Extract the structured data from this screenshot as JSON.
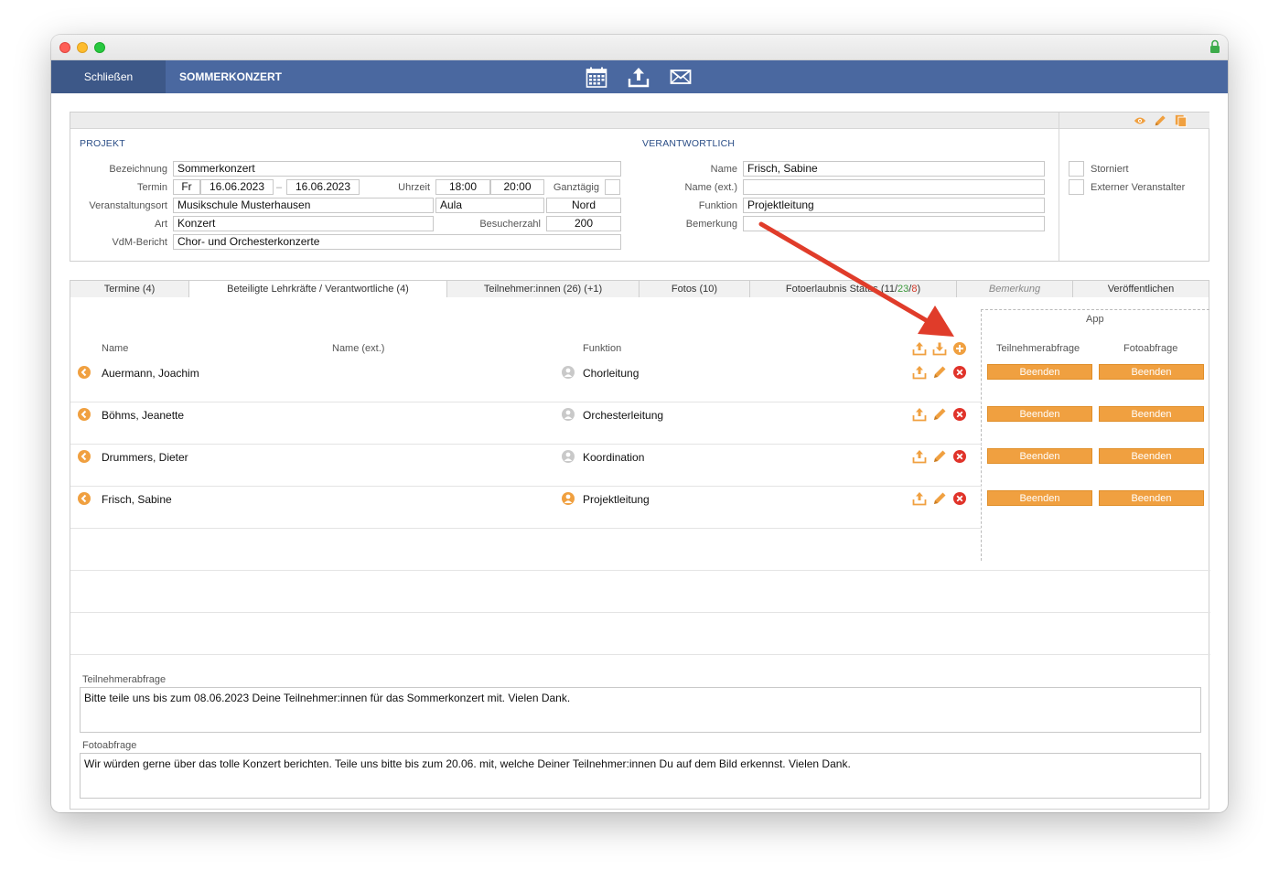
{
  "nav": {
    "close_label": "Schließen",
    "title": "SOMMERKONZERT",
    "icons": [
      "calendar-icon",
      "upload-icon",
      "mail-icon"
    ]
  },
  "projekt": {
    "section_title": "PROJEKT",
    "bezeichnung_label": "Bezeichnung",
    "bezeichnung_value": "Sommerkonzert",
    "termin_label": "Termin",
    "termin_day": "Fr",
    "termin_from": "16.06.2023",
    "termin_sep": "–",
    "termin_to": "16.06.2023",
    "uhrzeit_label": "Uhrzeit",
    "uhrzeit_from": "18:00",
    "uhrzeit_to": "20:00",
    "ganztaegig_label": "Ganztägig",
    "ort_label": "Veranstaltungsort",
    "ort_value": "Musikschule Musterhausen",
    "ort_room": "Aula",
    "ort_region": "Nord",
    "art_label": "Art",
    "art_value": "Konzert",
    "besucherzahl_label": "Besucherzahl",
    "besucherzahl_value": "200",
    "vdm_label": "VdM-Bericht",
    "vdm_value": "Chor- und Orchesterkonzerte"
  },
  "verantwortlich": {
    "section_title": "VERANTWORTLICH",
    "name_label": "Name",
    "name_value": "Frisch, Sabine",
    "name_ext_label": "Name (ext.)",
    "name_ext_value": "",
    "funktion_label": "Funktion",
    "funktion_value": "Projektleitung",
    "bemerkung_label": "Bemerkung",
    "bemerkung_value": ""
  },
  "flags": {
    "storniert_label": "Storniert",
    "externer_label": "Externer Veranstalter"
  },
  "tabs": {
    "termine": "Termine (4)",
    "lehrkraefte": "Beteiligte Lehrkräfte / Verantwortliche (4)",
    "teilnehmer": "Teilnehmer:innen (26) (+1)",
    "fotos": "Fotos (10)",
    "fotoerlaubnis_prefix": "Fotoerlaubnis Status (",
    "fotoerlaubnis_a": "11",
    "fotoerlaubnis_sep1": "/",
    "fotoerlaubnis_b": "23",
    "fotoerlaubnis_sep2": "/",
    "fotoerlaubnis_c": "8",
    "fotoerlaubnis_suffix": ")",
    "bemerkung": "Bemerkung",
    "veroeffentlichen": "Veröffentlichen"
  },
  "table": {
    "col_name": "Name",
    "col_name_ext": "Name (ext.)",
    "col_funktion": "Funktion",
    "app_title": "App",
    "col_teilnehmerabfrage": "Teilnehmerabfrage",
    "col_fotoabfrage": "Fotoabfrage",
    "button_label": "Beenden",
    "rows": [
      {
        "name": "Auermann, Joachim",
        "funktion": "Chorleitung"
      },
      {
        "name": "Böhms, Jeanette",
        "funktion": "Orchesterleitung"
      },
      {
        "name": "Drummers, Dieter",
        "funktion": "Koordination"
      },
      {
        "name": "Frisch, Sabine",
        "funktion": "Projektleitung"
      }
    ]
  },
  "teilnehmerabfrage": {
    "label": "Teilnehmerabfrage",
    "text": "Bitte teile uns bis zum 08.06.2023 Deine Teilnehmer:innen für das Sommerkonzert mit. Vielen Dank."
  },
  "fotoabfrage": {
    "label": "Fotoabfrage",
    "text": "Wir würden gerne über das tolle Konzert berichten. Teile uns bitte bis zum 20.06. mit, welche Deiner Teilnehmer:innen Du auf dem Bild erkennst. Vielen Dank."
  },
  "colors": {
    "nav": "#4a68a0",
    "accent": "#f0a040",
    "remove": "#e0332a",
    "annotation_arrow": "#e03c2a"
  }
}
